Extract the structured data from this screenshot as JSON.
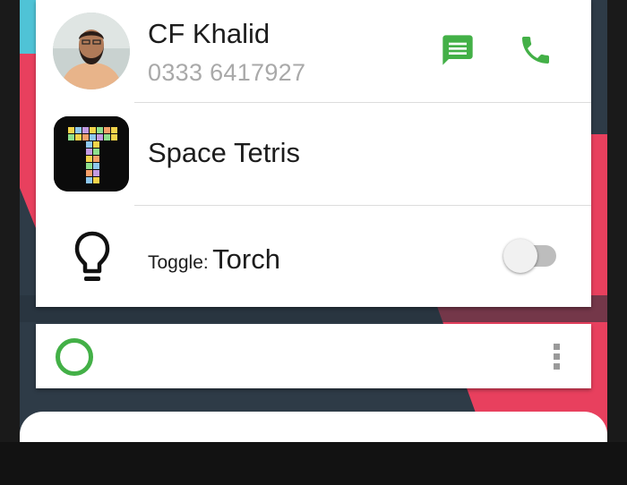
{
  "contact": {
    "name": "CF Khalid",
    "phone": "0333 6417927",
    "message_icon": "message-icon",
    "call_icon": "phone-icon"
  },
  "app": {
    "name": "Space Tetris",
    "icon": "tetris-app-icon"
  },
  "toggle": {
    "prefix": "Toggle:",
    "name": "Torch",
    "icon": "lightbulb-icon",
    "state": "off"
  },
  "search_bar": {
    "icon": "assistant-ring-icon",
    "menu_icon": "more-vert-icon"
  },
  "colors": {
    "accent_green": "#43b047",
    "wallpaper_dark": "#2e3b47",
    "wallpaper_red": "#e8405e",
    "wallpaper_cyan": "#4fc3d6"
  }
}
